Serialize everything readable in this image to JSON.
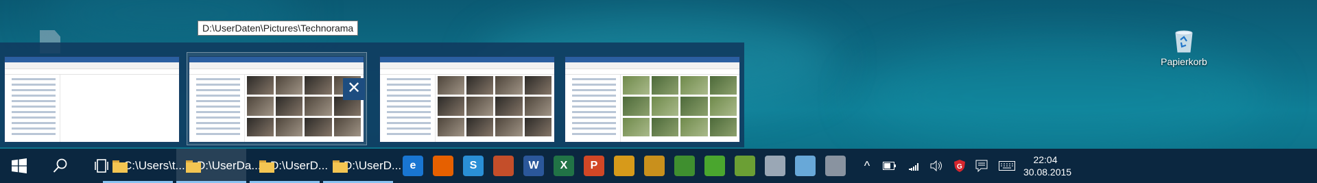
{
  "tooltip": {
    "path": "D:\\UserDaten\\Pictures\\Technorama"
  },
  "desktop": {
    "recycle_bin_label": "Papierkorb"
  },
  "preview": {
    "close_symbol": "✕",
    "thumbnails": [
      {
        "name": "thumbnail-window-1"
      },
      {
        "name": "thumbnail-window-2"
      },
      {
        "name": "thumbnail-window-3"
      },
      {
        "name": "thumbnail-window-4"
      }
    ]
  },
  "taskbar": {
    "start_icon": "windows-logo-icon",
    "search_icon": "search-icon",
    "taskview_icon": "task-view-icon",
    "explorer_windows": [
      {
        "label": "C:\\Users\\t...",
        "active": false
      },
      {
        "label": "D:\\UserDa...",
        "active": true
      },
      {
        "label": "D:\\UserD...",
        "active": false
      },
      {
        "label": "D:\\UserD...",
        "active": false
      }
    ],
    "pinned_apps": [
      {
        "icon": "edge-icon",
        "letter": "e",
        "color": "#1976d2"
      },
      {
        "icon": "firefox-icon",
        "letter": "",
        "color": "#e66000"
      },
      {
        "icon": "sync-icon",
        "letter": "S",
        "color": "#2a8fd6"
      },
      {
        "icon": "paint-icon",
        "letter": "",
        "color": "#c44e2a"
      },
      {
        "icon": "word-icon",
        "letter": "W",
        "color": "#2b579a"
      },
      {
        "icon": "excel-icon",
        "letter": "X",
        "color": "#217346"
      },
      {
        "icon": "powerpoint-icon",
        "letter": "P",
        "color": "#d24726"
      },
      {
        "icon": "clock-app-icon",
        "letter": "",
        "color": "#d79a1a"
      },
      {
        "icon": "clock-app-2-icon",
        "letter": "",
        "color": "#c9901c"
      },
      {
        "icon": "project-icon",
        "letter": "",
        "color": "#3f8f2f"
      },
      {
        "icon": "planner-icon",
        "letter": "",
        "color": "#4aa62e"
      },
      {
        "icon": "editor-icon",
        "letter": "",
        "color": "#6b9f34"
      },
      {
        "icon": "scissors-icon",
        "letter": "",
        "color": "#9aa7b5"
      },
      {
        "icon": "notes-icon",
        "letter": "",
        "color": "#68a8d8"
      },
      {
        "icon": "tools-icon",
        "letter": "",
        "color": "#8993a0"
      }
    ],
    "tray": {
      "chevron": "^",
      "battery_icon": "battery-icon",
      "wifi_icon": "wifi-icon",
      "volume_icon": "volume-icon",
      "antivirus_icon": "shield-g-icon",
      "notifications_icon": "action-center-icon",
      "keyboard_icon": "keyboard-icon"
    },
    "clock": {
      "time": "22:04",
      "date": "30.08.2015"
    }
  }
}
